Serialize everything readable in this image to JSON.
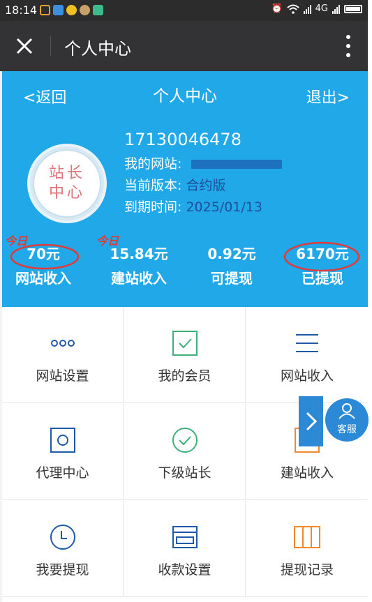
{
  "status_bar": {
    "time": "18:14",
    "network": "4G"
  },
  "app_bar": {
    "title": "个人中心"
  },
  "header": {
    "back_label": "<返回",
    "title": "个人中心",
    "logout_label": "退出>"
  },
  "profile": {
    "badge_line1": "站长",
    "badge_line2": "中心",
    "phone": "17130046478",
    "site_label": "我的网站:",
    "version_label": "当前版本:",
    "version_value": "合约版",
    "expiry_label": "到期时间:",
    "expiry_value": "2025/01/13"
  },
  "stats": [
    {
      "value": "70元",
      "label": "网站收入",
      "tag": "今日"
    },
    {
      "value": "15.84元",
      "label": "建站收入",
      "tag": "今日"
    },
    {
      "value": "0.92元",
      "label": "可提现"
    },
    {
      "value": "6170元",
      "label": "已提现"
    }
  ],
  "menu": [
    {
      "label": "网站设置",
      "icon": "dots-icon"
    },
    {
      "label": "我的会员",
      "icon": "check-square-icon"
    },
    {
      "label": "网站收入",
      "icon": "lines-icon"
    },
    {
      "label": "代理中心",
      "icon": "square-circle-icon"
    },
    {
      "label": "下级站长",
      "icon": "check-circle-icon"
    },
    {
      "label": "建站收入",
      "icon": "box-icon"
    },
    {
      "label": "我要提现",
      "icon": "clock-icon"
    },
    {
      "label": "收款设置",
      "icon": "card-icon"
    },
    {
      "label": "提现记录",
      "icon": "columns-icon"
    }
  ],
  "floating": {
    "service_label": "客服"
  },
  "colors": {
    "header_blue": "#21a8e8",
    "icon_blue": "#1f5aa8",
    "icon_green": "#3fb07a",
    "icon_orange": "#f0892e",
    "annotation_red": "#e03a3a"
  }
}
